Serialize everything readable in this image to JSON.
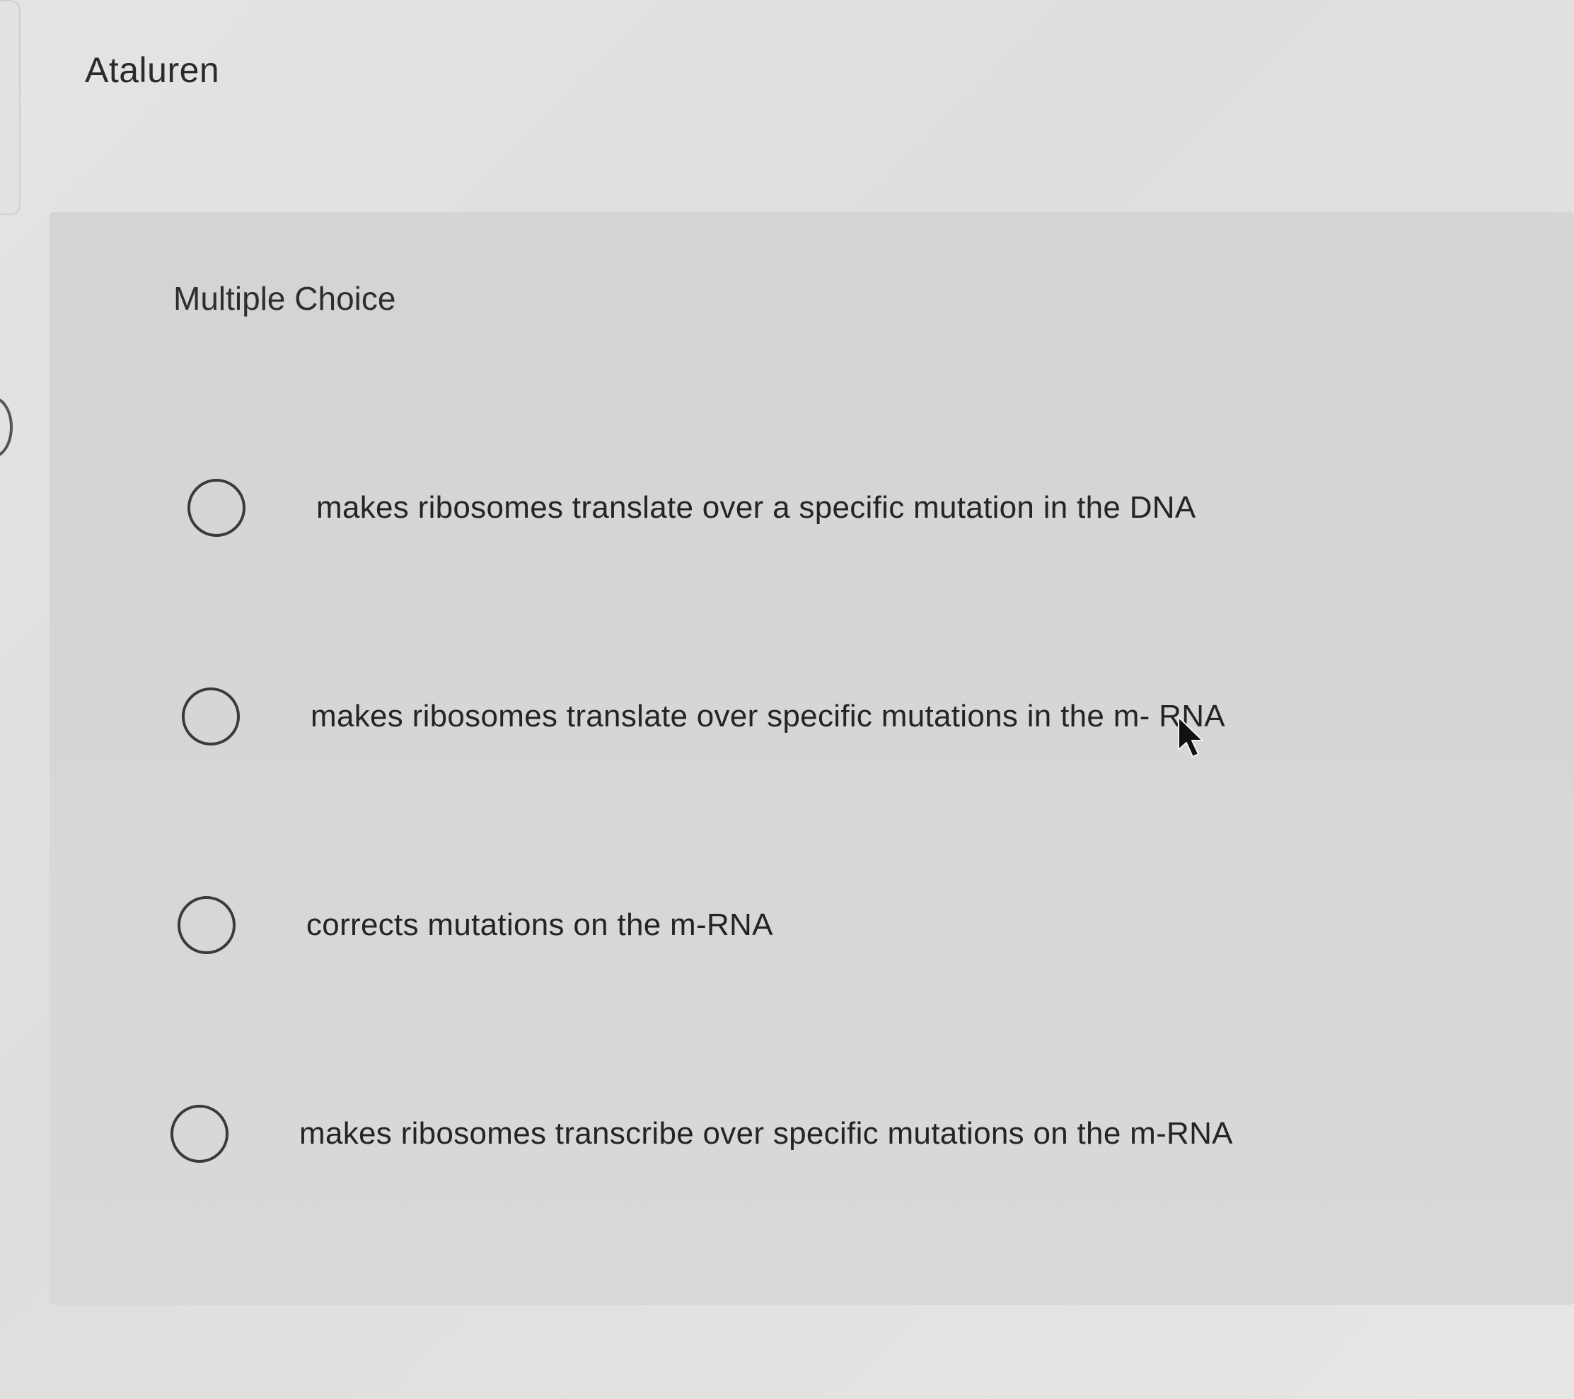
{
  "question": {
    "title": "Ataluren",
    "type_label": "Multiple Choice"
  },
  "options": [
    {
      "label": "makes ribosomes translate over a  specific mutation in the DNA",
      "selected": false
    },
    {
      "label": "makes ribosomes translate over specific mutations in the m- RNA",
      "selected": false
    },
    {
      "label": "corrects mutations on the m-RNA",
      "selected": false
    },
    {
      "label": "makes ribosomes transcribe over specific mutations on the m-RNA",
      "selected": false
    }
  ],
  "icons": {
    "radio": "radio-unchecked-icon",
    "cursor": "mouse-pointer-icon"
  },
  "colors": {
    "page_background": "#e2e2e0",
    "panel_background": "#d6d6d4",
    "text": "#2a2a2a",
    "radio_border": "#3a3a3a"
  }
}
